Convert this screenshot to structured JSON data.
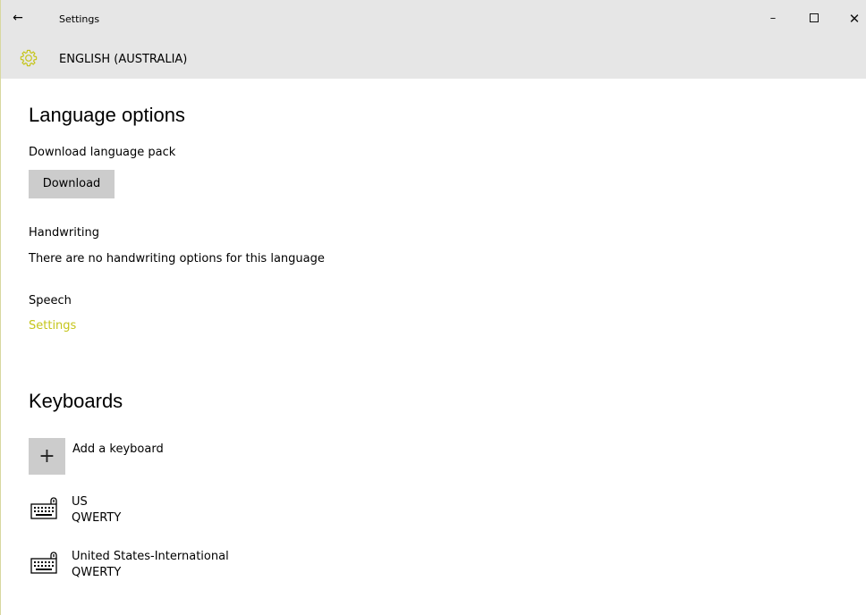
{
  "titlebar": {
    "title": "Settings",
    "back_glyph": "←",
    "minimize_glyph": "–",
    "close_glyph": "✕"
  },
  "header": {
    "title": "ENGLISH (AUSTRALIA)",
    "icon": "gear-icon",
    "accent_color": "#c5c51b"
  },
  "language_options": {
    "title": "Language options",
    "download_pack_label": "Download language pack",
    "download_button": "Download",
    "handwriting_label": "Handwriting",
    "handwriting_text": "There are no handwriting options for this language",
    "speech_label": "Speech",
    "speech_settings_link": "Settings"
  },
  "keyboards": {
    "title": "Keyboards",
    "add_glyph": "+",
    "add_label": "Add a keyboard",
    "items": [
      {
        "name": "US",
        "layout": "QWERTY"
      },
      {
        "name": "United States-International",
        "layout": "QWERTY"
      }
    ]
  }
}
